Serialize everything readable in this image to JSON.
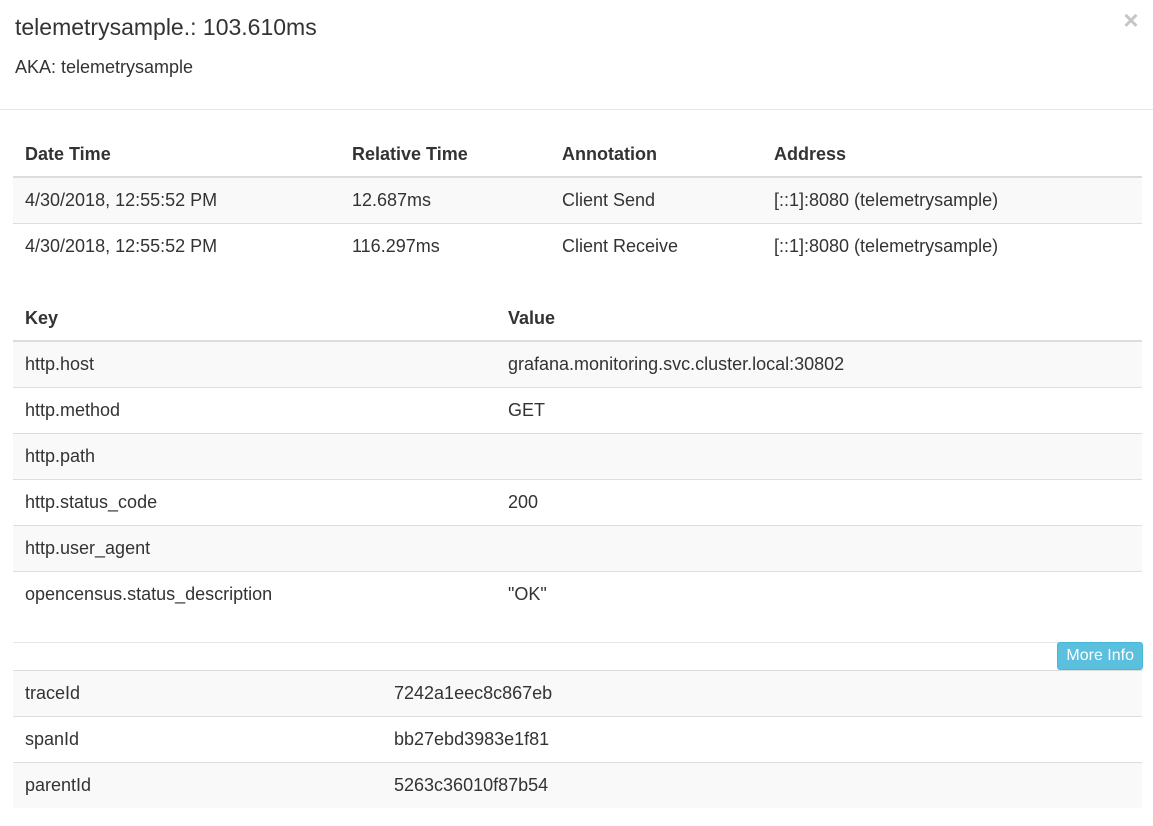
{
  "header": {
    "title": "telemetrysample.: 103.610ms",
    "aka": "AKA: telemetrysample",
    "close_glyph": "×"
  },
  "annotations": {
    "columns": [
      "Date Time",
      "Relative Time",
      "Annotation",
      "Address"
    ],
    "rows": [
      {
        "date_time": "4/30/2018, 12:55:52 PM",
        "relative_time": "12.687ms",
        "annotation": "Client Send",
        "address": "[::1]:8080 (telemetrysample)"
      },
      {
        "date_time": "4/30/2018, 12:55:52 PM",
        "relative_time": "116.297ms",
        "annotation": "Client Receive",
        "address": "[::1]:8080 (telemetrysample)"
      }
    ]
  },
  "tags": {
    "columns": [
      "Key",
      "Value"
    ],
    "rows": [
      {
        "key": "http.host",
        "value": "grafana.monitoring.svc.cluster.local:30802"
      },
      {
        "key": "http.method",
        "value": "GET"
      },
      {
        "key": "http.path",
        "value": ""
      },
      {
        "key": "http.status_code",
        "value": "200"
      },
      {
        "key": "http.user_agent",
        "value": ""
      },
      {
        "key": "opencensus.status_description",
        "value": "\"OK\""
      }
    ]
  },
  "more_info_label": "More Info",
  "ids": {
    "rows": [
      {
        "key": "traceId",
        "value": "7242a1eec8c867eb"
      },
      {
        "key": "spanId",
        "value": "bb27ebd3983e1f81"
      },
      {
        "key": "parentId",
        "value": "5263c36010f87b54"
      }
    ]
  },
  "colors": {
    "info_button": "#5bc0de",
    "stripe": "#f9f9f9",
    "border": "#dddddd"
  }
}
